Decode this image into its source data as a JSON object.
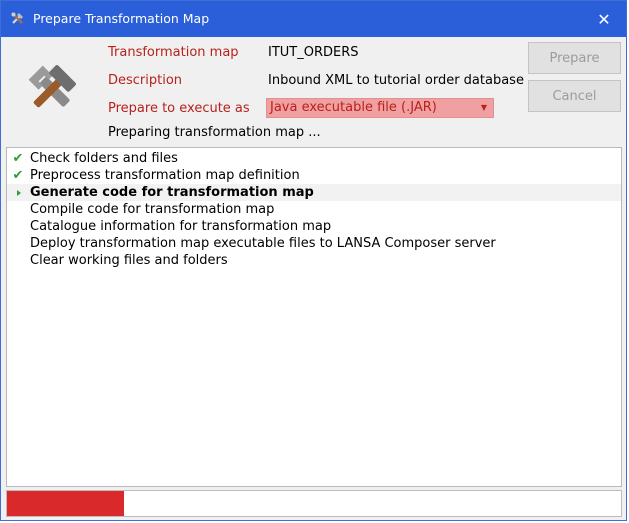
{
  "window": {
    "title": "Prepare Transformation Map",
    "close_glyph": "✕"
  },
  "form": {
    "transformation_map_label": "Transformation map",
    "transformation_map_value": "ITUT_ORDERS",
    "description_label": "Description",
    "description_value": "Inbound XML to tutorial order database",
    "execute_as_label": "Prepare to execute as",
    "execute_as_value": "Java executable file (.JAR)"
  },
  "buttons": {
    "prepare": "Prepare",
    "cancel": "Cancel"
  },
  "status_text": "Preparing transformation map ...",
  "steps": [
    {
      "label": "Check folders and files",
      "state": "done"
    },
    {
      "label": "Preprocess transformation map definition",
      "state": "done"
    },
    {
      "label": "Generate code for transformation map",
      "state": "current"
    },
    {
      "label": "Compile code for transformation map",
      "state": "pending"
    },
    {
      "label": "Catalogue information for transformation map",
      "state": "pending"
    },
    {
      "label": "Deploy transformation map executable files to LANSA Composer server",
      "state": "pending"
    },
    {
      "label": "Clear working files and folders",
      "state": "pending"
    }
  ],
  "progress": {
    "fraction": 0.19
  },
  "icons": {
    "app": "hammer-wrench-icon",
    "done": "checkmark-icon",
    "current": "triangle-arrow-icon",
    "close": "close-icon"
  },
  "colors": {
    "titlebar": "#2b5fd9",
    "label_red": "#b8211c",
    "select_bg": "#f0a0a0",
    "progress_fill": "#d9292b",
    "check_green": "#2e9e3a"
  }
}
